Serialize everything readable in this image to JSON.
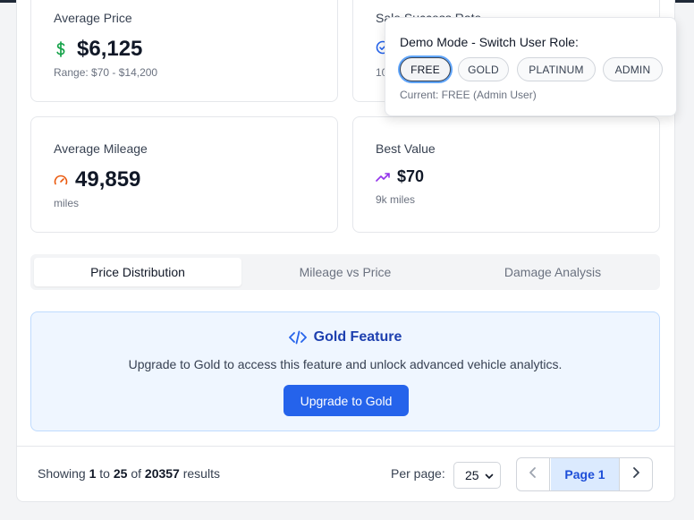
{
  "stats": {
    "avg_price": {
      "label": "Average Price",
      "value": "$6,125",
      "sub": "Range: $70 - $14,200",
      "icon": "dollar-icon"
    },
    "success_rate": {
      "label": "Sale Success Rate",
      "sub": "10"
    },
    "avg_mileage": {
      "label": "Average Mileage",
      "value": "49,859",
      "sub": "miles",
      "icon": "gauge-icon"
    },
    "best_value": {
      "label": "Best Value",
      "value": "$70",
      "sub": "9k miles",
      "icon": "trending-up-icon"
    }
  },
  "tabs": [
    {
      "label": "Price Distribution",
      "active": true
    },
    {
      "label": "Mileage vs Price",
      "active": false
    },
    {
      "label": "Damage Analysis",
      "active": false
    }
  ],
  "gold_feature": {
    "icon": "code-icon",
    "title": "Gold Feature",
    "description": "Upgrade to Gold to access this feature and unlock advanced vehicle analytics.",
    "button_label": "Upgrade to Gold"
  },
  "footer": {
    "showing_prefix": "Showing",
    "from": "1",
    "to_word": "to",
    "to": "25",
    "of_word": "of",
    "total": "20357",
    "suffix": "results",
    "per_page_label": "Per page:",
    "per_page_value": "25",
    "page_label": "Page 1"
  },
  "demo_mode": {
    "title": "Demo Mode - Switch User Role:",
    "roles": [
      "FREE",
      "GOLD",
      "PLATINUM",
      "ADMIN"
    ],
    "selected_role": "FREE",
    "current": "Current: FREE (Admin User)"
  },
  "colors": {
    "accent": "#2563eb",
    "dollar_icon": "#16a34a",
    "gauge_icon": "#ea580c",
    "trend_icon": "#9333ea",
    "check_icon": "#2563eb"
  }
}
